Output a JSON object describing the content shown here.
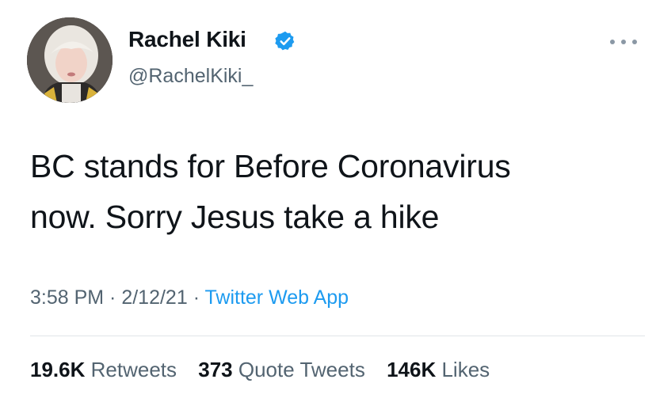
{
  "author": {
    "name": "Rachel Kiki",
    "handle": "@RachelKiki_"
  },
  "tweet": {
    "lines": [
      "BC stands for Before Coronavirus",
      "now. Sorry Jesus take a hike"
    ]
  },
  "meta": {
    "time": "3:58 PM",
    "separator_1": " · ",
    "date": "2/12/21",
    "separator_2": " · ",
    "source": "Twitter Web App"
  },
  "stats": {
    "retweets_count": "19.6K",
    "retweets_label": "Retweets",
    "quotes_count": "373",
    "quotes_label": "Quote Tweets",
    "likes_count": "146K",
    "likes_label": "Likes"
  },
  "colors": {
    "verified": "#1d9bf0",
    "link": "#1d9bf0",
    "secondary_text": "#536471"
  },
  "icons": {
    "verified": "verified-badge-icon",
    "more": "more-options-icon"
  }
}
